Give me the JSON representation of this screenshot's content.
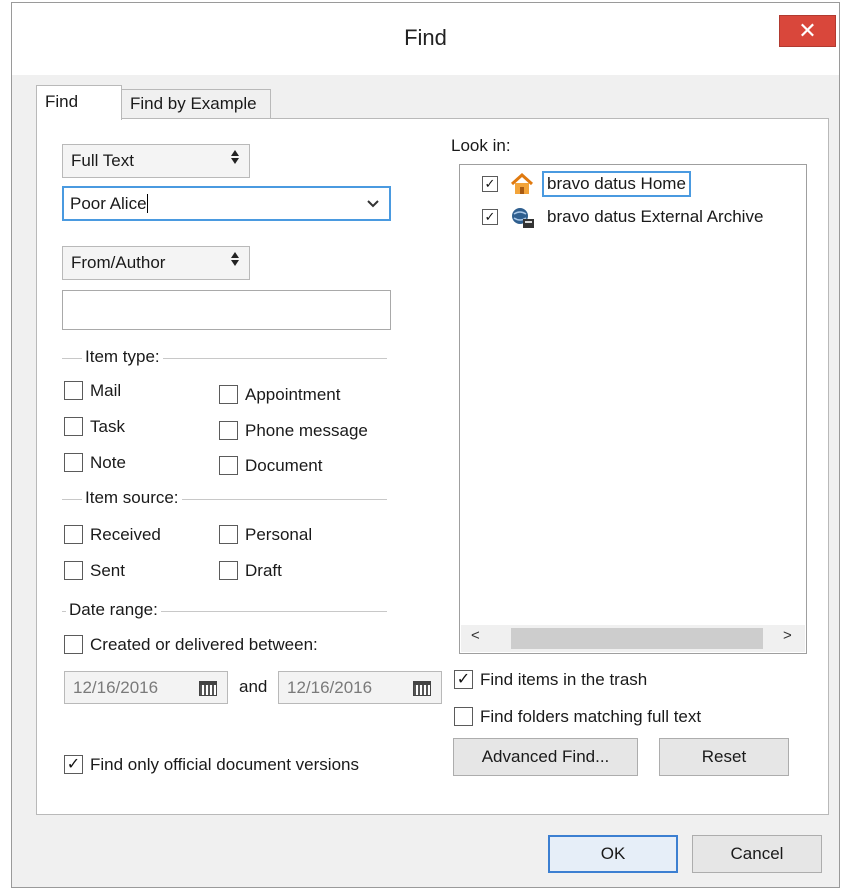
{
  "window": {
    "title": "Find",
    "close_glyph": "✕"
  },
  "tabs": [
    {
      "label": "Find"
    },
    {
      "label": "Find by Example"
    }
  ],
  "search": {
    "scope_select": "Full Text",
    "query_value": "Poor Alice",
    "field_select": "From/Author",
    "author_value": ""
  },
  "item_type": {
    "legend": "Item type:",
    "options": [
      {
        "label": "Mail",
        "checked": false
      },
      {
        "label": "Task",
        "checked": false
      },
      {
        "label": "Note",
        "checked": false
      },
      {
        "label": "Appointment",
        "checked": false
      },
      {
        "label": "Phone message",
        "checked": false
      },
      {
        "label": "Document",
        "checked": false
      }
    ]
  },
  "item_source": {
    "legend": "Item source:",
    "options": [
      {
        "label": "Received",
        "checked": false
      },
      {
        "label": "Sent",
        "checked": false
      },
      {
        "label": "Personal",
        "checked": false
      },
      {
        "label": "Draft",
        "checked": false
      }
    ]
  },
  "date_range": {
    "legend": "Date range:",
    "created_label": "Created or delivered between:",
    "created_checked": false,
    "from_date": "12/16/2016",
    "and_label": "and",
    "to_date": "12/16/2016"
  },
  "official_versions": {
    "label": "Find only official document versions",
    "checked": true
  },
  "look_in": {
    "label": "Look in:",
    "items": [
      {
        "label": "bravo datus Home",
        "checked": true,
        "icon": "home-icon"
      },
      {
        "label": "bravo datus External Archive",
        "checked": true,
        "icon": "network-archive-icon"
      }
    ]
  },
  "options": {
    "trash_label": "Find items in the trash",
    "trash_checked": true,
    "folders_label": "Find folders matching full text",
    "folders_checked": false
  },
  "buttons": {
    "advanced_find": "Advanced Find...",
    "reset": "Reset",
    "ok": "OK",
    "cancel": "Cancel"
  },
  "glyphs": {
    "check": "✓",
    "updown": "◆",
    "chevron": "∨",
    "scroll_left": "<",
    "scroll_right": ">"
  }
}
